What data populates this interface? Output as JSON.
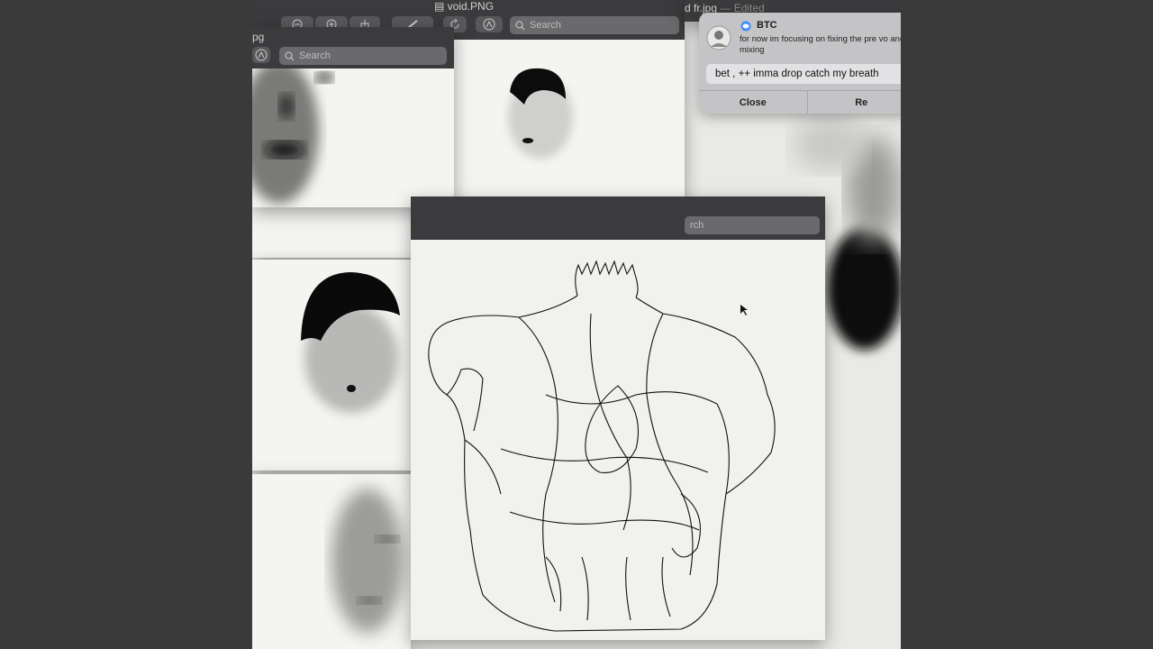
{
  "windows": {
    "back_left": {
      "title": "void.PNG"
    },
    "back_right": {
      "title": "d fr.jpg",
      "edited": "— Edited",
      "search_placeholder": "Search"
    },
    "small": {
      "title": "pg",
      "search_placeholder": "Search"
    },
    "torso": {
      "search_placeholder": "rch"
    }
  },
  "notification": {
    "app": "BTC",
    "message": "for now im focusing on fixing the pre vo and mixing",
    "reply": "bet , ++ imma drop catch my breath",
    "close_label": "Close",
    "reply_label": "Re"
  },
  "colors": {
    "toolbar": "#3b3b3d",
    "search": "#6a6a6d",
    "paper": "#f4f4f1",
    "ink": "#0d0d0d"
  }
}
